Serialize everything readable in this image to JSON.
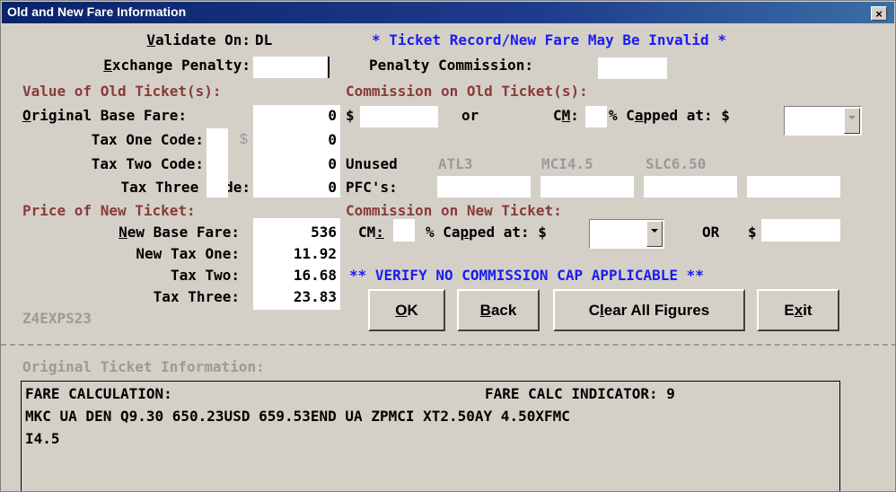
{
  "window": {
    "title": "Old and New Fare Information",
    "close_glyph": "×"
  },
  "top": {
    "validate_on_label": "Validate On:",
    "validate_on_value": "DL",
    "warning": "* Ticket Record/New Fare May Be Invalid *",
    "exchange_penalty_label": "Exchange Penalty:",
    "exchange_penalty_value": "",
    "penalty_commission_label": "Penalty Commission:",
    "penalty_commission_value": ""
  },
  "old_ticket": {
    "section_label": "Value of Old Ticket(s):",
    "original_base_fare_label": "Original Base Fare:",
    "original_base_fare_value": "0",
    "tax_one_code_label": "Tax One Code:",
    "tax_one_value": "0",
    "dollar_hint": "$",
    "tax_two_code_label": "Tax Two Code:",
    "tax_two_value": "0",
    "tax_three_code_label": "Tax Three Code:",
    "tax_three_value": "0"
  },
  "old_commission": {
    "section_label": "Commission on Old Ticket(s):",
    "dollar": "$",
    "or_label": "or",
    "cm_label": "CM:",
    "capped_label": "% Capped at: $",
    "cap_value": "",
    "amount_value": "",
    "cm_value": ""
  },
  "pfc": {
    "unused_label": "Unused",
    "codes": [
      "ATL3",
      "MCI4.5",
      "SLC6.50"
    ],
    "pfcs_label": "PFC's:",
    "fields": [
      "",
      "",
      "",
      ""
    ]
  },
  "new_ticket": {
    "section_label": "Price of New Ticket:",
    "new_base_fare_label": "New Base Fare:",
    "new_base_fare_value": "536",
    "new_tax_one_label": "New Tax One:",
    "new_tax_one_value": "11.92",
    "tax_two_label": "Tax Two:",
    "tax_two_value": "16.68",
    "tax_three_label": "Tax Three:",
    "tax_three_value": "23.83",
    "screen_id": "Z4EXPS23"
  },
  "new_commission": {
    "section_label": "Commission on New Ticket:",
    "cm_label": "CM:",
    "capped_label": "% Capped at: $",
    "or_label": "OR",
    "dollar": "$",
    "cap_value": "",
    "amount_value": "",
    "cm_value": ""
  },
  "notice": "** VERIFY NO COMMISSION CAP APPLICABLE **",
  "buttons": {
    "ok": "OK",
    "back": "Back",
    "clear": "Clear All Figures",
    "exit": "Exit"
  },
  "original_info": {
    "header": "Original Ticket Information:",
    "fare_calc_label": "FARE CALCULATION:",
    "fare_calc_indicator": "FARE CALC INDICATOR: 9",
    "line1": "MKC UA DEN Q9.30 650.23USD 659.53END UA ZPMCI XT2.50AY 4.50XFMC",
    "line2": "I4.5"
  },
  "colors": {
    "section_label": "#8a3a3a",
    "warning": "#1c1cf0",
    "disabled": "#9a9a9a",
    "title_bar": "#0a246a",
    "background": "#d4d0c8"
  }
}
